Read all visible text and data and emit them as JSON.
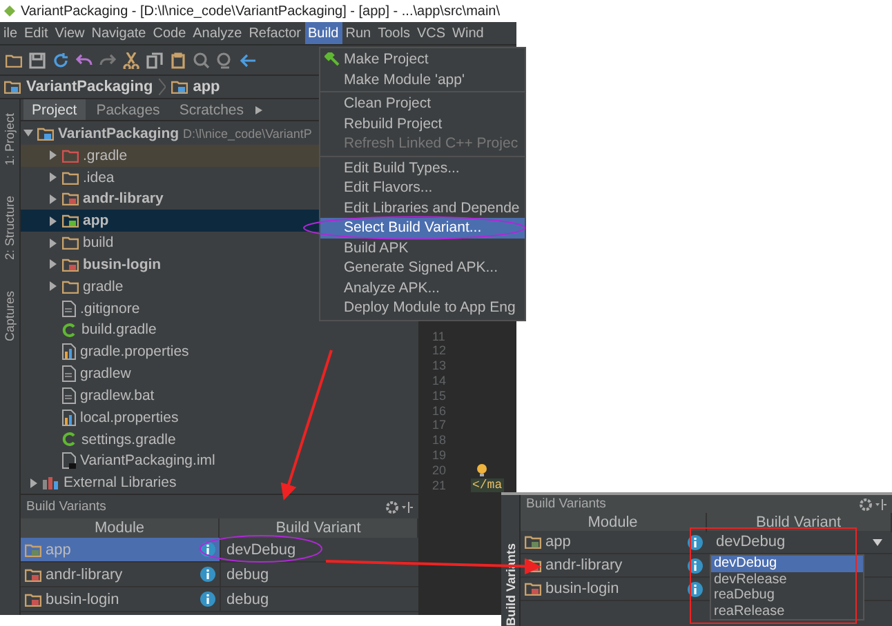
{
  "title_bar": {
    "title": "VariantPackaging - [D:\\l\\nice_code\\VariantPackaging] - [app] - ...\\app\\src\\main\\"
  },
  "menu_bar": [
    {
      "label": "ile",
      "selected": false
    },
    {
      "label": "Edit",
      "selected": false
    },
    {
      "label": "View",
      "selected": false
    },
    {
      "label": "Navigate",
      "selected": false
    },
    {
      "label": "Code",
      "selected": false
    },
    {
      "label": "Analyze",
      "selected": false
    },
    {
      "label": "Refactor",
      "selected": false
    },
    {
      "label": "Build",
      "selected": true
    },
    {
      "label": "Run",
      "selected": false
    },
    {
      "label": "Tools",
      "selected": false
    },
    {
      "label": "VCS",
      "selected": false
    },
    {
      "label": "Wind",
      "selected": false
    }
  ],
  "breadcrumb": [
    "VariantPackaging",
    "app"
  ],
  "tool_tabs": [
    {
      "label": "Project",
      "selected": true
    },
    {
      "label": "Packages",
      "selected": false
    },
    {
      "label": "Scratches",
      "selected": false
    }
  ],
  "side_tabs": [
    "1: Project",
    "2: Structure",
    "Captures"
  ],
  "project_tree": {
    "label": "VariantPackaging",
    "path": "D:\\l\\nice_code\\VariantP",
    "expanded": true,
    "children": [
      {
        "label": ".gradle",
        "kind": "excluded",
        "expanded": false,
        "selected": false
      },
      {
        "label": ".idea",
        "kind": "folder",
        "expanded": false,
        "selected": false
      },
      {
        "label": "andr-library",
        "kind": "module",
        "expanded": false,
        "selected": false
      },
      {
        "label": "app",
        "kind": "module",
        "expanded": false,
        "selected": true
      },
      {
        "label": "build",
        "kind": "folder",
        "expanded": false,
        "selected": false
      },
      {
        "label": "busin-login",
        "kind": "module",
        "expanded": false,
        "selected": false
      },
      {
        "label": "gradle",
        "kind": "folder",
        "expanded": false,
        "selected": false
      },
      {
        "label": ".gitignore",
        "kind": "file",
        "selected": false
      },
      {
        "label": "build.gradle",
        "kind": "gradle",
        "selected": false
      },
      {
        "label": "gradle.properties",
        "kind": "properties",
        "selected": false
      },
      {
        "label": "gradlew",
        "kind": "file",
        "selected": false
      },
      {
        "label": "gradlew.bat",
        "kind": "file",
        "selected": false
      },
      {
        "label": "local.properties",
        "kind": "properties",
        "selected": false
      },
      {
        "label": "settings.gradle",
        "kind": "gradle",
        "selected": false
      },
      {
        "label": "VariantPackaging.iml",
        "kind": "iml",
        "selected": false
      }
    ]
  },
  "external_libraries": {
    "label": "External Libraries",
    "expanded": false
  },
  "editor_gutter": {
    "line_numbers": [
      "11",
      "12",
      "13",
      "14",
      "15",
      "16",
      "17",
      "18",
      "19",
      "20",
      "21"
    ],
    "code_fragment": "</ma"
  },
  "build_menu": {
    "items": [
      {
        "kind": "item",
        "label": "Make Project",
        "disabled": false,
        "selected": false
      },
      {
        "kind": "item",
        "label": "Make Module 'app'",
        "disabled": false,
        "selected": false
      },
      {
        "kind": "separator"
      },
      {
        "kind": "item",
        "label": "Clean Project",
        "disabled": false,
        "selected": false
      },
      {
        "kind": "item",
        "label": "Rebuild Project",
        "disabled": false,
        "selected": false
      },
      {
        "kind": "item",
        "label": "Refresh Linked C++ Projec",
        "disabled": true,
        "selected": false
      },
      {
        "kind": "separator"
      },
      {
        "kind": "item",
        "label": "Edit Build Types...",
        "disabled": false,
        "selected": false
      },
      {
        "kind": "item",
        "label": "Edit Flavors...",
        "disabled": false,
        "selected": false
      },
      {
        "kind": "item",
        "label": "Edit Libraries and Depende",
        "disabled": false,
        "selected": false
      },
      {
        "kind": "item",
        "label": "Select Build Variant...",
        "disabled": false,
        "selected": true
      },
      {
        "kind": "item",
        "label": "Build APK",
        "disabled": false,
        "selected": false
      },
      {
        "kind": "item",
        "label": "Generate Signed APK...",
        "disabled": false,
        "selected": false
      },
      {
        "kind": "item",
        "label": "Analyze APK...",
        "disabled": false,
        "selected": false
      },
      {
        "kind": "item",
        "label": "Deploy Module to App Eng",
        "disabled": false,
        "selected": false
      }
    ]
  },
  "build_variants_panel": {
    "title": "Build Variants",
    "columns": [
      "Module",
      "Build Variant"
    ],
    "rows": [
      {
        "module": "app",
        "variant": "devDebug",
        "selected": true
      },
      {
        "module": "andr-library",
        "variant": "debug",
        "selected": false
      },
      {
        "module": "busin-login",
        "variant": "debug",
        "selected": false
      }
    ]
  },
  "inset_panel": {
    "side_tab": "Build Variants",
    "title": "Build Variants",
    "columns": [
      "Module",
      "Build Variant"
    ],
    "rows": [
      {
        "module": "app",
        "variant": "devDebug",
        "selected": false
      },
      {
        "module": "andr-library",
        "selected": false
      },
      {
        "module": "busin-login",
        "selected": false
      }
    ],
    "dropdown_options": [
      {
        "label": "devDebug",
        "selected": true
      },
      {
        "label": "devRelease",
        "selected": false
      },
      {
        "label": "reaDebug",
        "selected": false
      },
      {
        "label": "reaRelease",
        "selected": false
      }
    ]
  }
}
